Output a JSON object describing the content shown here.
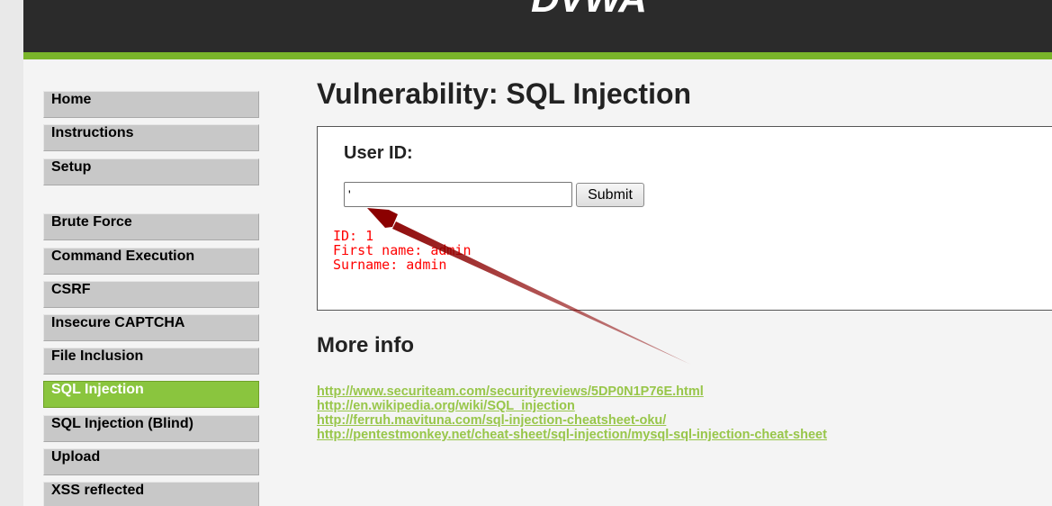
{
  "header": {
    "logo_text": "DVWA",
    "accent_color": "#7ab52a"
  },
  "sidebar": {
    "group1": [
      {
        "label": "Home"
      },
      {
        "label": "Instructions"
      },
      {
        "label": "Setup"
      }
    ],
    "group2": [
      {
        "label": "Brute Force"
      },
      {
        "label": "Command Execution"
      },
      {
        "label": "CSRF"
      },
      {
        "label": "Insecure CAPTCHA"
      },
      {
        "label": "File Inclusion"
      },
      {
        "label": "SQL Injection",
        "active": true
      },
      {
        "label": "SQL Injection (Blind)"
      },
      {
        "label": "Upload"
      },
      {
        "label": "XSS reflected"
      }
    ],
    "active_color": "#8ac53e"
  },
  "main": {
    "title": "Vulnerability: SQL Injection",
    "form": {
      "label": "User ID:",
      "input_value": "'",
      "submit_label": "Submit"
    },
    "result": {
      "line1": "ID: 1",
      "line2": "First name: admin",
      "line3": "Surname: admin",
      "color": "#ff0000"
    },
    "more_info_title": "More info",
    "links": [
      "http://www.securiteam.com/securityreviews/5DP0N1P76E.html",
      "http://en.wikipedia.org/wiki/SQL_injection",
      "http://ferruh.mavituna.com/sql-injection-cheatsheet-oku/",
      "http://pentestmonkey.net/cheat-sheet/sql-injection/mysql-sql-injection-cheat-sheet"
    ],
    "link_color": "#98c64a"
  },
  "annotation": {
    "arrow_color": "#8b0000"
  }
}
